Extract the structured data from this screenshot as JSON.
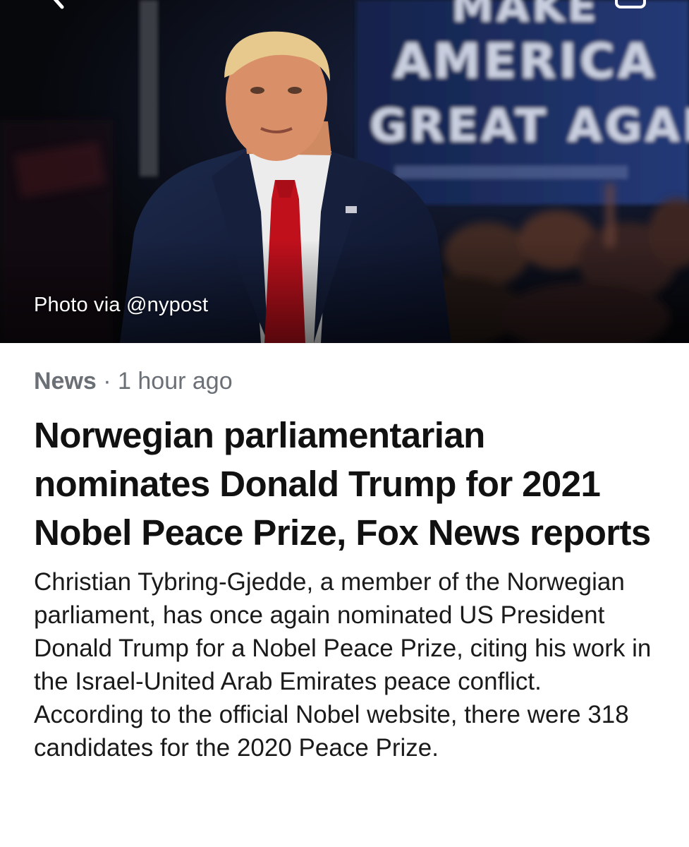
{
  "hero": {
    "image_description_icon": "photo",
    "photo_credit": "Photo via @nypost",
    "back_icon": "chevron-left-icon",
    "share_icon": "share-icon"
  },
  "article": {
    "category": "News",
    "separator": " · ",
    "time_ago": "1 hour ago",
    "headline": "Norwegian parliamentarian nominates Donald Trump for 2021 Nobel Peace Prize, Fox News reports",
    "summary": "Christian Tybring-Gjedde, a member of the Norwegian parliament, has once again nominated US President Donald Trump for a Nobel Peace Prize, citing his work in the Israel-United Arab Emirates peace conflict. According to the official Nobel website, there were 318 candidates for the 2020 Peace Prize."
  },
  "colors": {
    "meta_text": "#6b7076",
    "headline_text": "#111111",
    "banner_blue": "#1c2f63",
    "tie_red": "#c0101c"
  }
}
